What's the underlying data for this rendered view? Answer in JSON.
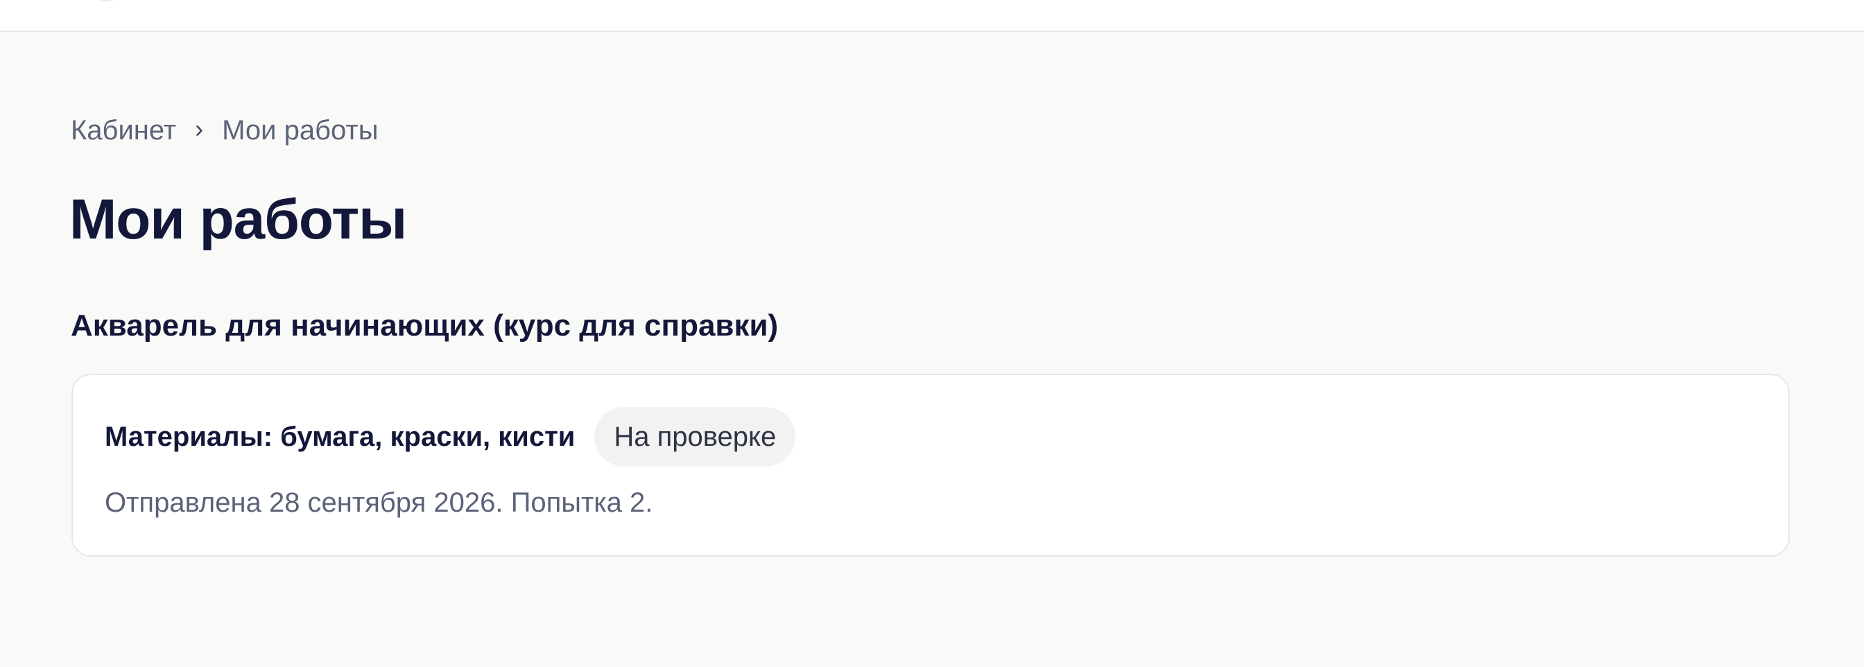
{
  "breadcrumb": {
    "items": [
      "Кабинет",
      "Мои работы"
    ],
    "separator": "›"
  },
  "page": {
    "title": "Мои работы"
  },
  "course": {
    "title": "Акварель для начинающих (курс для справки)"
  },
  "work": {
    "title": "Материалы: бумага, краски, кисти",
    "status": "На проверке",
    "submitted": "Отправлена 28 сентября 2026. Попытка 2."
  },
  "colors": {
    "background": "#f9f9f8",
    "heading": "#13183a",
    "muted_text": "#5c6378",
    "badge_background": "#f2f2f2",
    "card_border": "#e6e6e6"
  },
  "icons": {
    "logo": "logo-icon",
    "breadcrumb_separator": "chevron-right-icon"
  }
}
